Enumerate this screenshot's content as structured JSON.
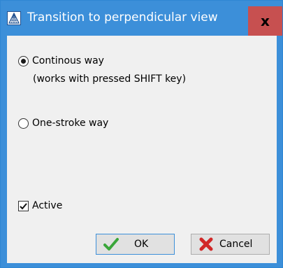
{
  "window": {
    "title": "Transition to perpendicular view",
    "close_label": "x"
  },
  "options": {
    "continuous_label": "Continous way",
    "continuous_note": "(works with pressed SHIFT key)",
    "continuous_selected": true,
    "one_stroke_label": "One-stroke way",
    "one_stroke_selected": false
  },
  "active": {
    "label": "Active",
    "checked": true
  },
  "buttons": {
    "ok_label": "OK",
    "cancel_label": "Cancel"
  },
  "colors": {
    "title_bar": "#3c8fd9",
    "close_button": "#c75050",
    "dialog_background": "#f0f0f0",
    "ok_icon": "#3aa63a",
    "cancel_icon": "#d12828"
  },
  "icons": {
    "app": "perspective-grid-icon",
    "ok": "green-checkmark-icon",
    "cancel": "red-x-icon"
  }
}
